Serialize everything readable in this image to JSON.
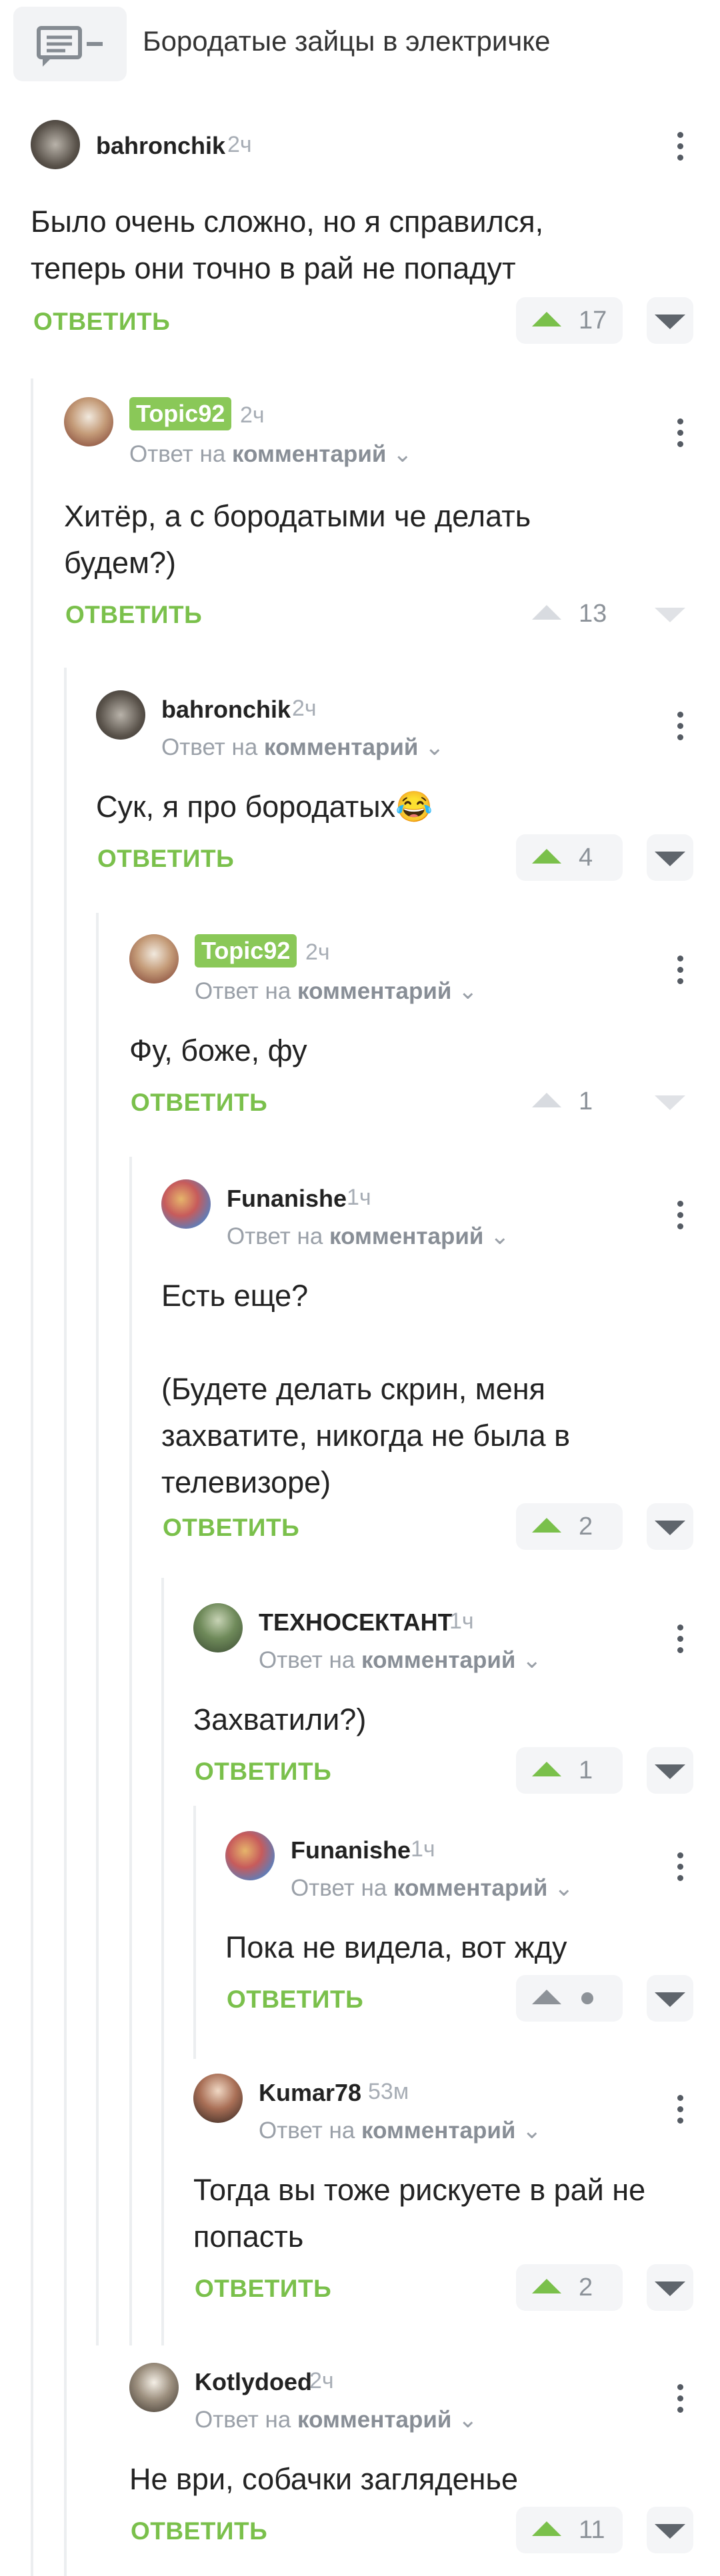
{
  "post": {
    "title": "Бородатые зайцы в электричке",
    "icon": "comments-icon"
  },
  "common": {
    "reply_label": "ОТВЕТИТЬ",
    "reply_to_prefix": "Ответ на",
    "reply_to_target": "комментарий"
  },
  "comments": [
    {
      "author": "bahronchik",
      "time": "2ч",
      "text": "Было очень сложно, но я справился,\nтеперь они точно в рай не попадут",
      "rating": "17"
    },
    {
      "author": "Topic92",
      "time": "2ч",
      "text": "Хитёр, а с бородатыми че делать\nбудем?)",
      "rating": "13"
    },
    {
      "author": "bahronchik",
      "time": "2ч",
      "text": "Сук, я про бородатых😂",
      "rating": "4"
    },
    {
      "author": "Topic92",
      "time": "2ч",
      "text": "Фу, боже, фу",
      "rating": "1"
    },
    {
      "author": "Funanishe",
      "time": "1ч",
      "text": "Есть еще?\n\n(Будете делать скрин, меня\nзахватите, никогда не была в\nтелевизоре)",
      "rating": "2"
    },
    {
      "author": "ТЕХНОСЕКТАНТ",
      "time": "1ч",
      "text": "Захватили?)",
      "rating": "1"
    },
    {
      "author": "Funanishe",
      "time": "1ч",
      "text": "Пока не видела, вот жду",
      "rating": ""
    },
    {
      "author": "Kumar78",
      "time": "53м",
      "text": "Тогда вы тоже рискуете в рай не\nпопасть",
      "rating": "2"
    },
    {
      "author": "Kotlydoed",
      "time": "2ч",
      "text": "Не ври, собачки загляденье",
      "rating": "11"
    }
  ],
  "colors": {
    "accent_green": "#7ac04b",
    "badge_green": "#8ac858",
    "muted_text": "#9aa0a8",
    "thread_line": "#eceef0"
  }
}
